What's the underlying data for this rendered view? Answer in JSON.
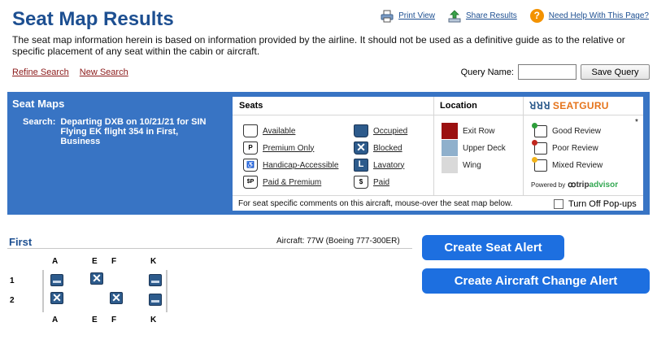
{
  "page": {
    "title": "Seat Map Results"
  },
  "toplinks": {
    "print": "Print View",
    "share": "Share Results",
    "help": "Need Help With This Page?"
  },
  "disclaimer": "The seat map information herein is based on information provided by the airline. It should not be used as a definitive guide as to the relative or specific placement of any seat within the cabin or aircraft.",
  "nav": {
    "refine": "Refine Search",
    "new": "New Search"
  },
  "query": {
    "label": "Query Name:",
    "value": "",
    "save": "Save Query"
  },
  "panel": {
    "title": "Seat Maps",
    "search_label": "Search:",
    "search_line1": "Departing DXB on 10/21/21 for SIN",
    "search_line2": "Flying EK flight 354 in First, Business"
  },
  "legend": {
    "seats_header": "Seats",
    "location_header": "Location",
    "seats": [
      {
        "label": "Available",
        "icon": "available-seat-icon"
      },
      {
        "label": "Occupied",
        "icon": "occupied-seat-icon"
      },
      {
        "label": "Premium Only",
        "icon": "premium-seat-icon",
        "mark": "P"
      },
      {
        "label": "Blocked",
        "icon": "blocked-seat-icon",
        "mark": "✕"
      },
      {
        "label": "Handicap-Accessible",
        "icon": "handicap-seat-icon",
        "mark": "♿"
      },
      {
        "label": "Lavatory",
        "icon": "lavatory-icon",
        "mark": "L"
      },
      {
        "label": "Paid & Premium",
        "icon": "paid-premium-seat-icon",
        "mark": "$P"
      },
      {
        "label": "Paid",
        "icon": "paid-seat-icon",
        "mark": "$"
      }
    ],
    "location": [
      {
        "label": "Exit Row",
        "color": "#9b1010"
      },
      {
        "label": "Upper Deck",
        "color": "#8fb0cc"
      },
      {
        "label": "Wing",
        "color": "#d9d9d9"
      }
    ],
    "seatguru": {
      "brand": "SEATGURU",
      "asterisk": "*",
      "reviews": [
        {
          "label": "Good Review",
          "color": "#2e9e3a"
        },
        {
          "label": "Poor Review",
          "color": "#c0261e"
        },
        {
          "label": "Mixed Review",
          "color": "#f2b31a"
        }
      ],
      "powered": "Powered by",
      "tripadvisor_trip": "trip",
      "tripadvisor_advisor": "advisor"
    },
    "footer": "For seat specific comments on this aircraft, mouse-over the seat map below.",
    "popups": "Turn Off Pop-ups"
  },
  "cabin": {
    "name": "First",
    "aircraft": "Aircraft: 77W (Boeing 777-300ER)",
    "columns": [
      "A",
      "E",
      "F",
      "K"
    ],
    "rows": [
      {
        "number": "1",
        "seats": {
          "A": "occupied",
          "E": "blocked",
          "F": "none",
          "K": "occupied"
        }
      },
      {
        "number": "2",
        "seats": {
          "A": "blocked",
          "E": "none",
          "F": "blocked",
          "K": "occupied"
        }
      }
    ]
  },
  "alerts": {
    "seat": "Create Seat Alert",
    "aircraft": "Create Aircraft Change Alert"
  }
}
